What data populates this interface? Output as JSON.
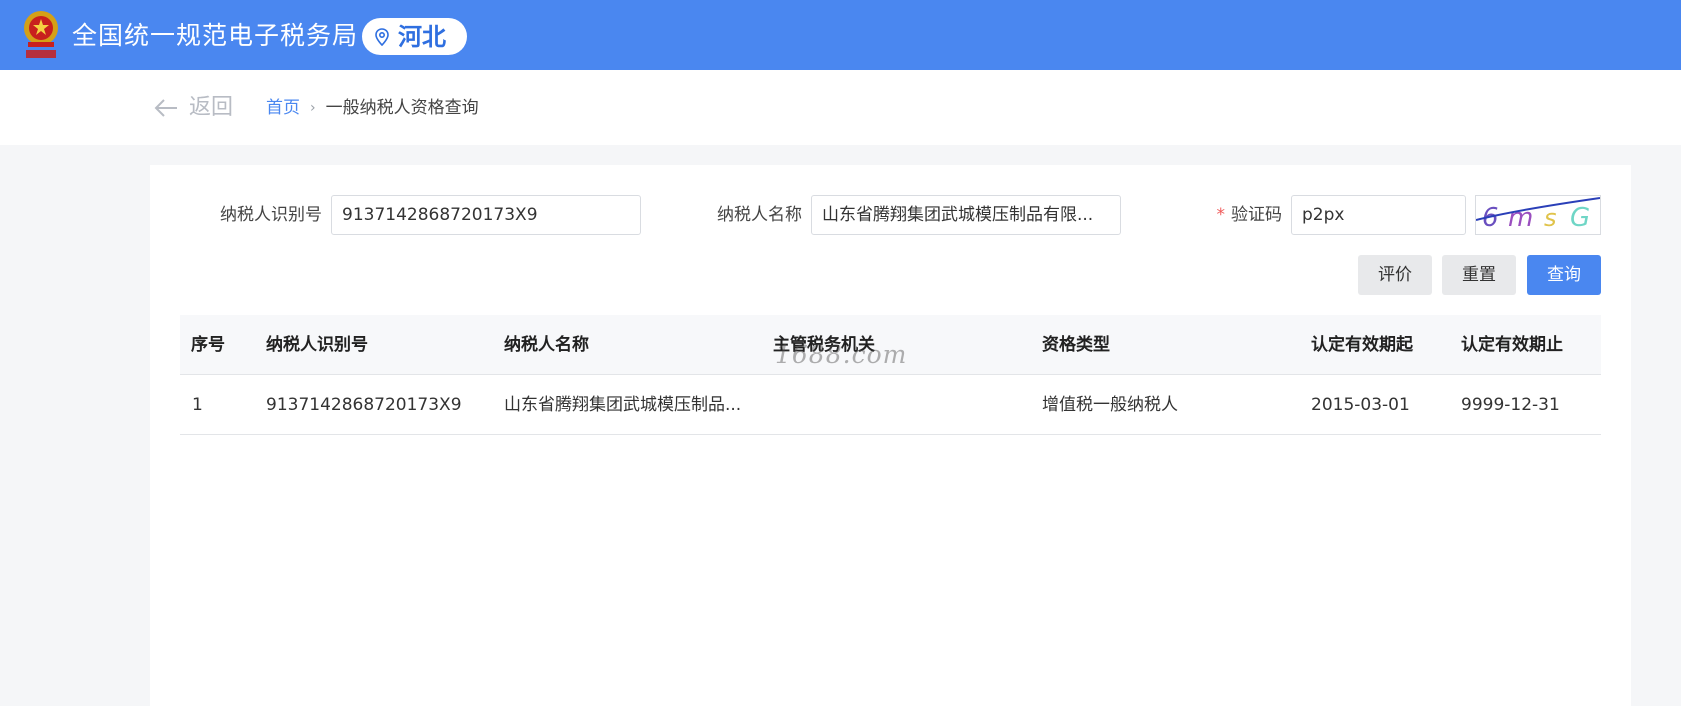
{
  "header": {
    "title": "全国统一规范电子税务局",
    "region": "河北"
  },
  "nav": {
    "back_label": "返回",
    "breadcrumb_home": "首页",
    "breadcrumb_current": "一般纳税人资格查询"
  },
  "form": {
    "taxpayer_id_label": "纳税人识别号",
    "taxpayer_id_value": "9137142868720173X9",
    "taxpayer_name_label": "纳税人名称",
    "taxpayer_name_value": "山东省腾翔集团武城模压制品有限...",
    "captcha_required_mark": "*",
    "captcha_label": "验证码",
    "captcha_value": "p2px",
    "captcha_image_text": "6msG"
  },
  "buttons": {
    "evaluate": "评价",
    "reset": "重置",
    "query": "查询"
  },
  "table": {
    "headers": [
      "序号",
      "纳税人识别号",
      "纳税人名称",
      "主管税务机关",
      "资格类型",
      "认定有效期起",
      "认定有效期止"
    ],
    "rows": [
      [
        "1",
        "9137142868720173X9",
        "山东省腾翔集团武城模压制品...",
        "",
        "增值税一般纳税人",
        "2015-03-01",
        "9999-12-31"
      ]
    ]
  },
  "watermark": "1688.com",
  "colors": {
    "header_bg": "#4a87f0",
    "accent": "#4a87f0",
    "required": "#f05a5a"
  }
}
